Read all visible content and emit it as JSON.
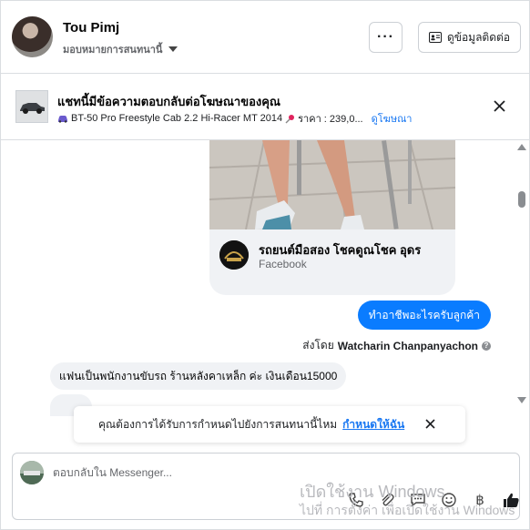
{
  "header": {
    "contact_name": "Tou Pimj",
    "assign_label": "มอบหมายการสนทนานี้",
    "more_label": "···",
    "details_label": "ดูข้อมูลติดต่อ"
  },
  "ad_reply": {
    "title": "แชทนี้มีข้อความตอบกลับต่อโฆษณาของคุณ",
    "product": "BT-50 Pro Freestyle Cab 2.2 Hi-Racer MT 2014",
    "price": "ราคา : 239,0...",
    "view_ad_link": "ดูโฆษณา"
  },
  "thread": {
    "card_title": "รถยนต์มือสอง โชคดูณโชค อุดร",
    "card_source": "Facebook",
    "outgoing_message": "ทำอาชีพอะไรครับลูกค้า",
    "sent_by_label": "ส่งโดย",
    "sent_by_name": "Watcharin Chanpanyachon",
    "incoming_message": "แฟนเป็นพนักงานขับรถ ร้านหลังคาเหล็ก ค่ะ เงินเดือน15000"
  },
  "toast": {
    "message": "คุณต้องการได้รับการกำหนดไปยังการสนทนานี้ไหม",
    "action": "กำหนดให้ฉัน"
  },
  "composer": {
    "placeholder": "ตอบกลับใน Messenger..."
  },
  "watermark": {
    "line1": "เปิดใช้งาน Windows",
    "line2": "ไปที่ การตั้งค่า เพื่อเปิดใช้งาน Windows"
  },
  "colors": {
    "accent": "#0a7cff",
    "link": "#1877f2",
    "bubble_gray": "#f0f2f5"
  },
  "icons": [
    "caret-down-icon",
    "contact-card-icon",
    "car-icon",
    "pin-icon",
    "close-icon",
    "info-icon",
    "attach-icon",
    "gif-icon",
    "emoji-icon",
    "baht-icon",
    "thumbs-up-icon",
    "phone-icon"
  ]
}
